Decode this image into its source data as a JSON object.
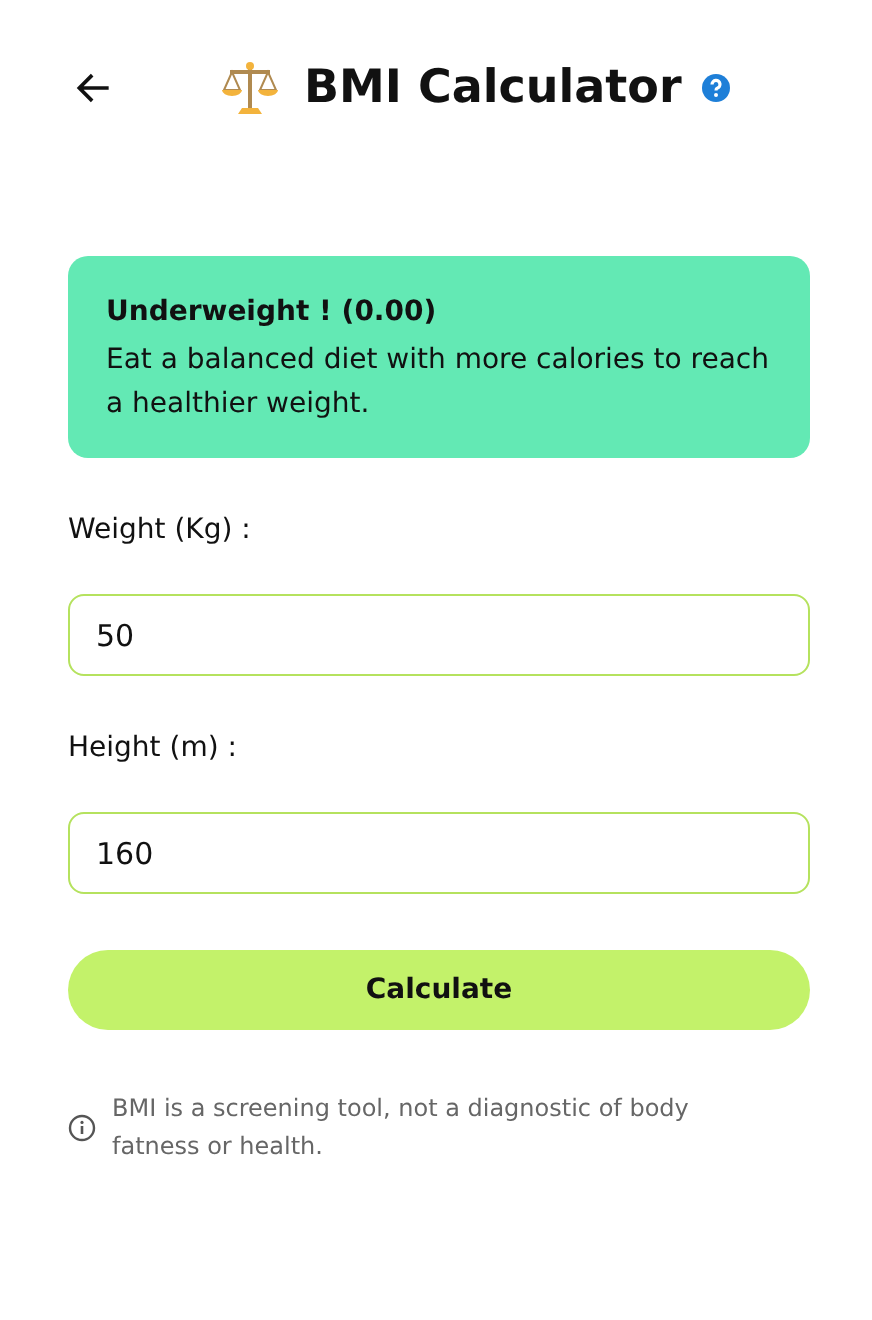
{
  "header": {
    "title": "BMI Calculator"
  },
  "result": {
    "title": "Underweight ! (0.00)",
    "message": "Eat a balanced diet with more calories to reach a healthier weight.",
    "color": "#63e9b4"
  },
  "fields": [
    {
      "label": "Weight (Kg) :",
      "value": "50"
    },
    {
      "label": "Height (m) :",
      "value": "160"
    }
  ],
  "button": {
    "label": "Calculate"
  },
  "note": {
    "text": "BMI is a screening tool, not a diagnostic of body fatness or health."
  }
}
